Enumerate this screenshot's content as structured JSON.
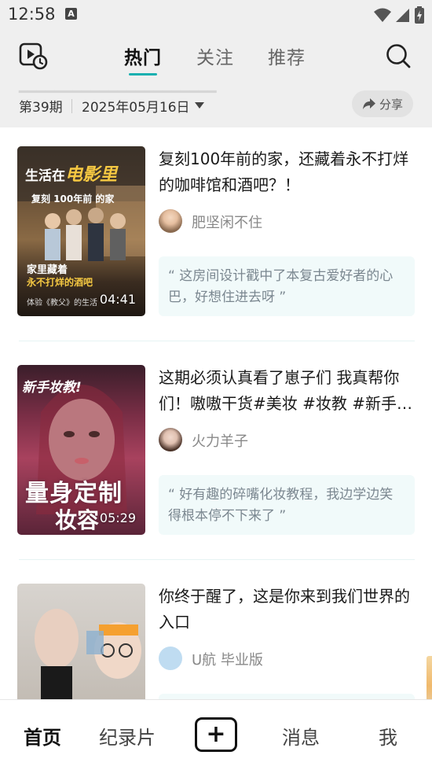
{
  "status_bar": {
    "time": "12:58",
    "notification_glyph": "A"
  },
  "header": {
    "tabs": [
      {
        "label": "热门",
        "active": true
      },
      {
        "label": "关注",
        "active": false
      },
      {
        "label": "推荐",
        "active": false
      }
    ],
    "left_icon": "history-play-icon",
    "right_icon": "search-icon"
  },
  "issue_bar": {
    "issue": "第39期",
    "date": "2025年05月16日",
    "share_label": "分享"
  },
  "feed": [
    {
      "title": "复刻100年前的家，还藏着永不打烊的咖啡馆和酒吧？！",
      "author": "肥坚闲不住",
      "comment": "“ 这房间设计戳中了本复古爱好者的心巴，好想住进去呀 ”",
      "duration": "04:41",
      "thumb_text": {
        "top_line_a": "生活在",
        "top_line_b": "电影里",
        "mid_line": "复刻 100年前 的家",
        "lower_a": "家里藏着",
        "lower_b": "永不打烊的酒吧",
        "bottom": "体验《教父》的生活"
      }
    },
    {
      "title": "这期必须认真看了崽子们 我真帮你们！嗷嗷干货#美妆 #妆教 #新手…",
      "author": "火力羊子",
      "comment": "“ 好有趣的碎嘴化妆教程，我边学边笑得根本停不下来了 ”",
      "duration": "05:29",
      "thumb_text": {
        "top": "新手妆教!",
        "big_1": "量身定制",
        "big_2": "妆容"
      }
    },
    {
      "title": "你终于醒了，这是你来到我们世界的入口",
      "author": "U航 毕业版",
      "comment": "",
      "duration": ""
    }
  ],
  "bottom_nav": {
    "items": [
      {
        "label": "首页",
        "active": true
      },
      {
        "label": "纪录片",
        "active": false
      },
      {
        "label": "消息",
        "active": false
      },
      {
        "label": "我",
        "active": false
      }
    ],
    "add_label": "+"
  }
}
